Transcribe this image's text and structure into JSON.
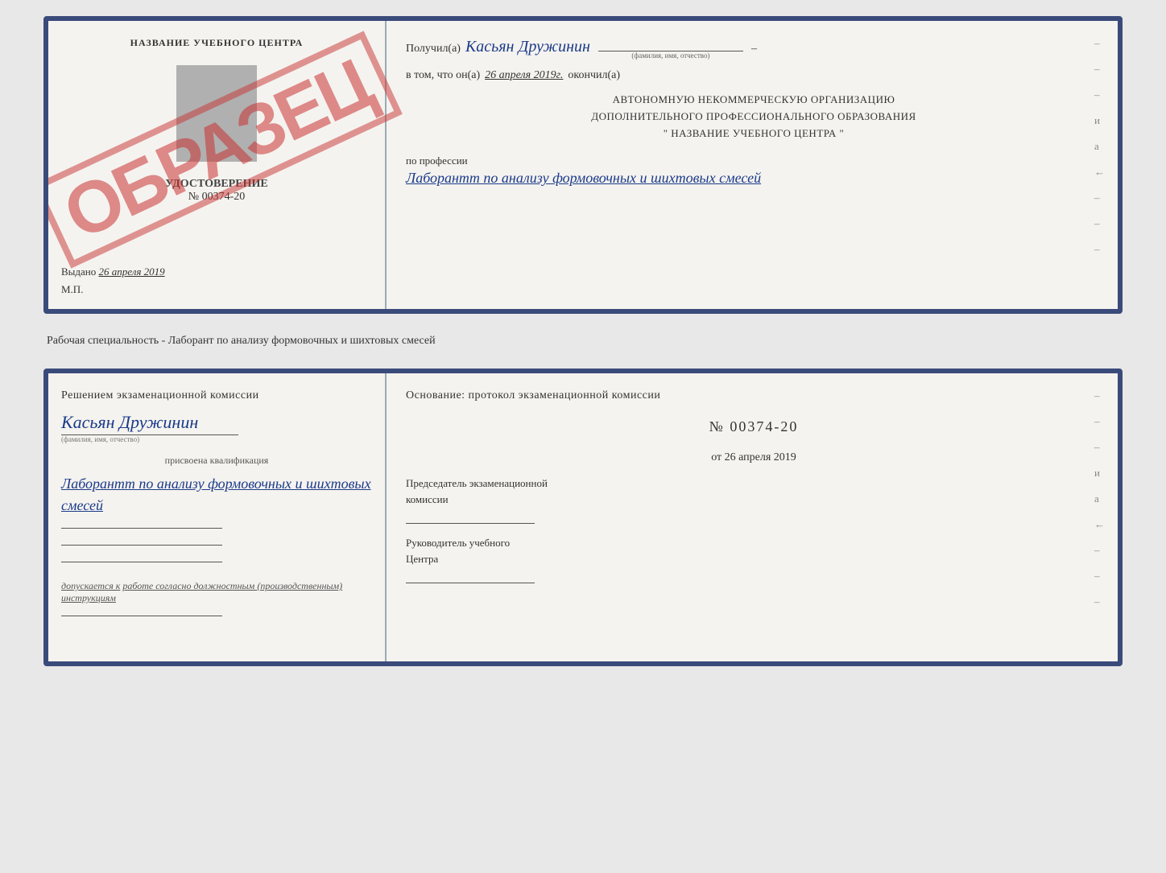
{
  "top_doc": {
    "left": {
      "title": "НАЗВАНИЕ УЧЕБНОГО ЦЕНТРА",
      "stamp": "ОБРАЗЕЦ",
      "cert_label": "УДОСТОВЕРЕНИЕ",
      "cert_number": "№ 00374-20",
      "vydano_label": "Выдано",
      "vydano_date": "26 апреля 2019",
      "mp_label": "М.П."
    },
    "right": {
      "poluchil_label": "Получил(а)",
      "recipient_name": "Касьян Дружинин",
      "fio_label": "(фамилия, имя, отчество)",
      "vtom_label": "в том, что он(а)",
      "date_value": "26 апреля 2019г.",
      "okonchil_label": "окончил(а)",
      "org_line1": "АВТОНОМНУЮ НЕКОММЕРЧЕСКУЮ ОРГАНИЗАЦИЮ",
      "org_line2": "ДОПОЛНИТЕЛЬНОГО ПРОФЕССИОНАЛЬНОГО ОБРАЗОВАНИЯ",
      "org_name": "\" НАЗВАНИЕ УЧЕБНОГО ЦЕНТРА \"",
      "profession_label": "по профессии",
      "profession_handwritten": "Лаборантт по анализу формовочных и шихтовых смесей",
      "side_items": [
        "–",
        "–",
        "–",
        "и",
        "а",
        "←",
        "–",
        "–",
        "–"
      ]
    }
  },
  "separator": {
    "text": "Рабочая специальность - Лаборант по анализу формовочных и шихтовых смесей"
  },
  "bottom_doc": {
    "left": {
      "decision_text": "Решением экзаменационной комиссии",
      "person_name": "Касьян Дружинин",
      "fio_label": "(фамилия, имя, отчество)",
      "kvali_label": "присвоена квалификация",
      "kvali_name": "Лаборантт по анализу формовочных и шихтовых смесей",
      "dopuskaetsya": "допускается к",
      "dopuskaetsya_underline": "работе согласно должностным (производственным) инструкциям"
    },
    "right": {
      "osnovanie_text": "Основание: протокол экзаменационной комиссии",
      "protocol_number": "№ 00374-20",
      "ot_label": "от",
      "ot_date": "26 апреля 2019",
      "predsedatel_line1": "Председатель экзаменационной",
      "predsedatel_line2": "комиссии",
      "rukovoditel_line1": "Руководитель учебного",
      "rukovoditel_line2": "Центра",
      "side_items": [
        "–",
        "–",
        "–",
        "и",
        "а",
        "←",
        "–",
        "–",
        "–"
      ]
    }
  }
}
